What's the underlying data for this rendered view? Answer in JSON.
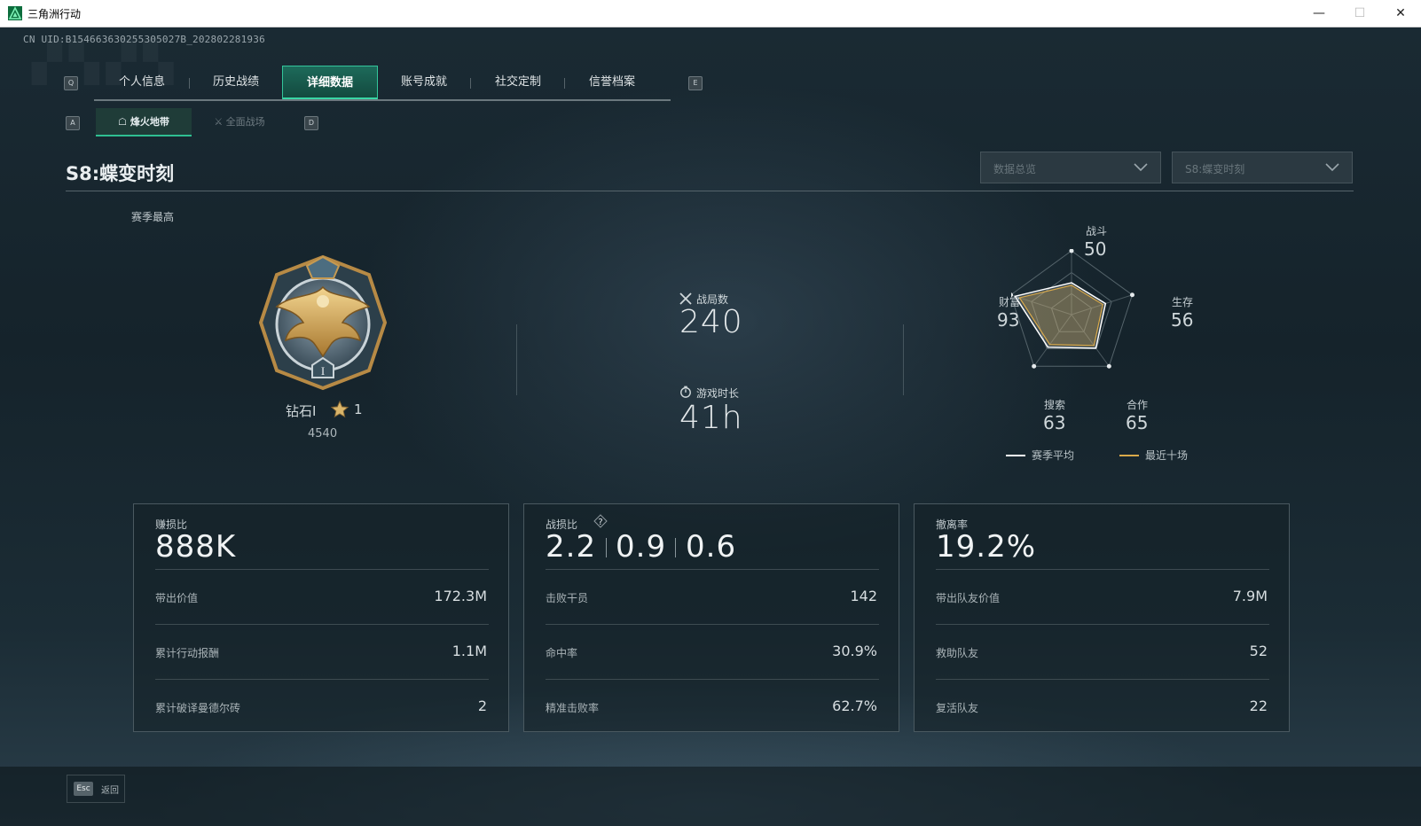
{
  "window": {
    "title": "三角洲行动",
    "min": "—",
    "max": "☐",
    "close": "✕"
  },
  "uid": "CN UID:B154663630255305027B_202802281936",
  "nav": {
    "prev_key": "Q",
    "next_key": "E",
    "tabs": [
      "个人信息",
      "历史战绩",
      "详细数据",
      "账号成就",
      "社交定制",
      "信誉档案"
    ],
    "active_tab": "详细数据"
  },
  "subnav": {
    "prev_key": "A",
    "next_key": "D",
    "tabs": [
      "烽火地带",
      "全面战场"
    ],
    "active_tab": "烽火地带"
  },
  "season": {
    "title": "S8:蝶变时刻",
    "filter_1": "数据总览",
    "filter_2": "S8:蝶变时刻",
    "high_label": "赛季最高"
  },
  "rank": {
    "name": "钻石I",
    "stars": "1",
    "points": "4540"
  },
  "overview": {
    "matches_label": "战局数",
    "matches": "240",
    "playtime_label": "游戏时长",
    "playtime": "41h"
  },
  "radar": {
    "axes": [
      {
        "label": "战斗",
        "value": "50"
      },
      {
        "label": "生存",
        "value": "56"
      },
      {
        "label": "合作",
        "value": "65"
      },
      {
        "label": "搜索",
        "value": "63"
      },
      {
        "label": "财富",
        "value": "93"
      }
    ],
    "legend": [
      {
        "label": "赛季平均",
        "color": "#ffffff"
      },
      {
        "label": "最近十场",
        "color": "#d9a94a"
      }
    ]
  },
  "cards": [
    {
      "label": "赚损比",
      "big": "888K",
      "rows": [
        {
          "label": "带出价值",
          "value": "172.3M"
        },
        {
          "label": "累计行动报酬",
          "value": "1.1M"
        },
        {
          "label": "累计破译曼德尔砖",
          "value": "2"
        }
      ]
    },
    {
      "label": "战损比",
      "ratios": [
        "2.2",
        "0.9",
        "0.6"
      ],
      "help": "?",
      "rows": [
        {
          "label": "击败干员",
          "value": "142"
        },
        {
          "label": "命中率",
          "value": "30.9%"
        },
        {
          "label": "精准击败率",
          "value": "62.7%"
        }
      ]
    },
    {
      "label": "撤离率",
      "big": "19.2%",
      "rows": [
        {
          "label": "带出队友价值",
          "value": "7.9M"
        },
        {
          "label": "救助队友",
          "value": "52"
        },
        {
          "label": "复活队友",
          "value": "22"
        }
      ]
    }
  ],
  "footer": {
    "esc_key": "Esc",
    "esc_label": "返回"
  }
}
